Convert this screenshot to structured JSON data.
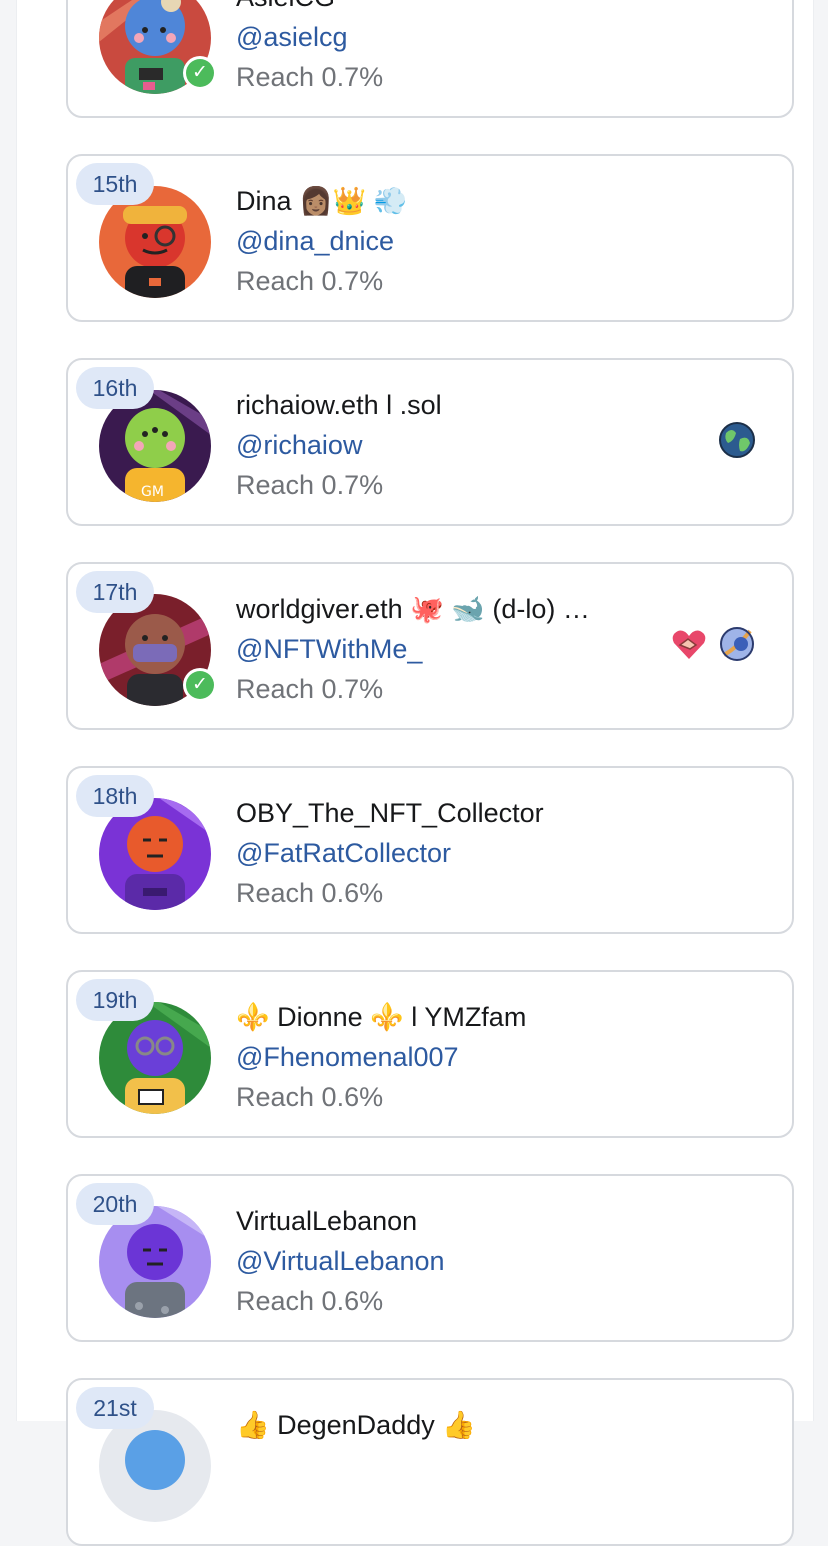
{
  "accounts": [
    {
      "rank": "",
      "name": "AsielCG",
      "handle": "@asielcg",
      "reach": "Reach 0.7%"
    },
    {
      "rank": "15th",
      "name": "Dina 👩🏽‍👑 💨",
      "handle": "@dina_dnice",
      "reach": "Reach 0.7%"
    },
    {
      "rank": "16th",
      "name": "richaiow.eth l .sol",
      "handle": "@richaiow",
      "reach": "Reach 0.7%"
    },
    {
      "rank": "17th",
      "name": "worldgiver.eth 🐙 🐋 (d-lo) …",
      "handle": "@NFTWithMe_",
      "reach": "Reach 0.7%"
    },
    {
      "rank": "18th",
      "name": "OBY_The_NFT_Collector",
      "handle": "@FatRatCollector",
      "reach": "Reach 0.6%"
    },
    {
      "rank": "19th",
      "name": "⚜️ Dionne ⚜️ l YMZfam",
      "handle": "@Fhenomenal007",
      "reach": "Reach 0.6%"
    },
    {
      "rank": "20th",
      "name": "VirtualLebanon",
      "handle": "@VirtualLebanon",
      "reach": "Reach 0.6%"
    },
    {
      "rank": "21st",
      "name": "👍 DegenDaddy 👍",
      "handle": "",
      "reach": ""
    }
  ],
  "icons": {
    "verified": "verified-check-icon",
    "globe": "globe-badge-icon",
    "handshake": "handshake-heart-badge-icon",
    "planet": "planet-badge-icon"
  },
  "colors": {
    "rank_bg": "#dfe8f7",
    "rank_text": "#2f5189",
    "handle": "#2d5aa0",
    "reach": "#707378",
    "verified": "#4cbb5b"
  }
}
